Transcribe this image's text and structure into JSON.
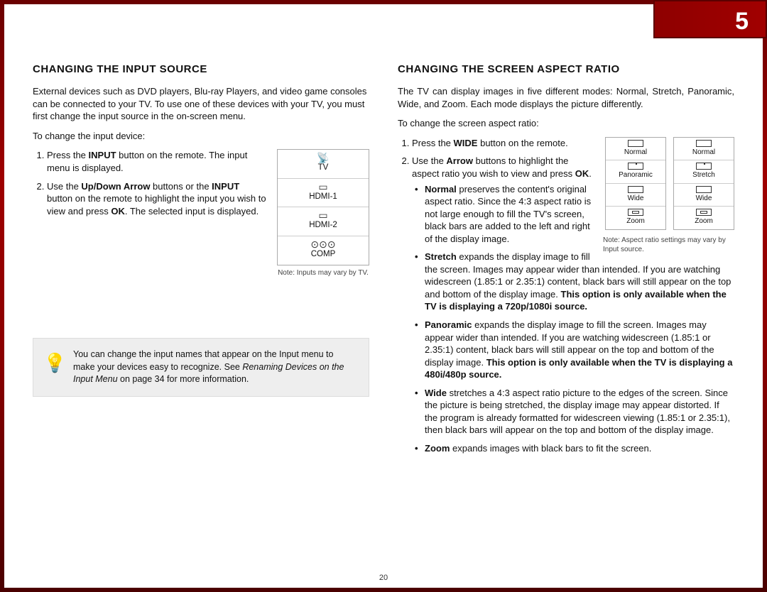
{
  "page_number": "5",
  "footer_page": "20",
  "left": {
    "heading": "CHANGING THE INPUT SOURCE",
    "intro": "External devices such as DVD players, Blu-ray Players, and video game consoles can be connected to your TV.  To use one of these devices with your TV, you must first change the input source in the on-screen menu.",
    "lead": "To change the input device:",
    "step1_a": "Press the ",
    "step1_b": "INPUT",
    "step1_c": " button on the remote. The input menu is displayed.",
    "step2_a": "Use the ",
    "step2_b": "Up/Down Arrow",
    "step2_c": " buttons or the ",
    "step2_d": "INPUT",
    "step2_e": " button on the remote to highlight the input you wish to view and press ",
    "step2_f": "OK",
    "step2_g": ". The selected input is displayed.",
    "menu_items": {
      "tv": "TV",
      "h1": "HDMI-1",
      "h2": "HDMI-2",
      "comp": "COMP"
    },
    "menu_note": "Note: Inputs may vary by TV.",
    "tip_a": "You can change the input names that appear on the Input menu to make your devices easy to recognize. See ",
    "tip_i": "Renaming Devices on the Input Menu",
    "tip_b": " on page 34 for more information."
  },
  "right": {
    "heading": "CHANGING THE SCREEN ASPECT RATIO",
    "intro": "The TV can display images in five different modes: Normal, Stretch, Panoramic, Wide, and Zoom. Each mode displays the picture differently.",
    "lead": "To change the screen aspect ratio:",
    "step1_a": "Press the ",
    "step1_b": "WIDE",
    "step1_c": " button on the remote.",
    "step2_a": "Use the ",
    "step2_b": "Arrow",
    "step2_c": " buttons to highlight the aspect ratio you wish to view and press ",
    "step2_d": "OK",
    "step2_e": ".",
    "aspect_labels": {
      "normal": "Normal",
      "panoramic": "Panoramic",
      "wide": "Wide",
      "zoom": "Zoom",
      "stretch": "Stretch"
    },
    "aspect_note": "Note: Aspect ratio settings may vary by Input source.",
    "bullet_normal_a": "Normal",
    "bullet_normal_b": " preserves the content's original aspect ratio. Since the 4:3 aspect ratio is not large enough to fill the TV's screen, black bars are added to the left and right of the display image.",
    "bullet_stretch_a": "Stretch",
    "bullet_stretch_b": " expands the display image to fill the screen. Images may appear wider than intended. If you are watching widescreen (1.85:1 or 2.35:1) content, black bars will still appear on the top and bottom of the display image. ",
    "bullet_stretch_c": "This option is only available when the TV is displaying a 720p/1080i source.",
    "bullet_pan_a": "Panoramic",
    "bullet_pan_b": " expands the display image to fill the screen. Images may appear wider than intended. If you are watching widescreen (1.85:1 or 2.35:1) content, black bars will still appear on the top and bottom of the display image. ",
    "bullet_pan_c": "This option is only available when the TV is displaying a 480i/480p source.",
    "bullet_wide_a": "Wide",
    "bullet_wide_b": " stretches a 4:3 aspect ratio picture to the edges of the screen. Since the picture is being stretched, the display image may appear distorted. If the program is already formatted for widescreen viewing (1.85:1 or 2.35:1), then black bars will appear on the top and bottom of the display image.",
    "bullet_zoom_a": "Zoom",
    "bullet_zoom_b": " expands images with black bars to fit the screen."
  }
}
